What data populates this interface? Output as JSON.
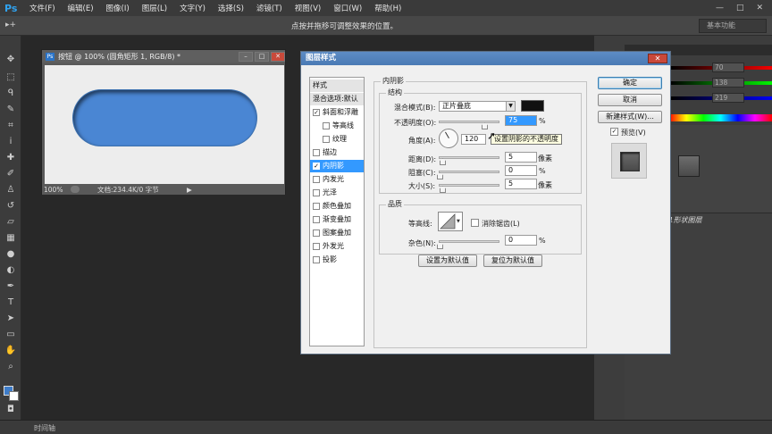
{
  "menubar": {
    "logo": "Ps",
    "items": [
      "文件(F)",
      "编辑(E)",
      "图像(I)",
      "图层(L)",
      "文字(Y)",
      "选择(S)",
      "滤镜(T)",
      "视图(V)",
      "窗口(W)",
      "帮助(H)"
    ],
    "minimize": "—",
    "maximize": "□",
    "close": "✕"
  },
  "optbar": {
    "tool_glyph": "▸+",
    "hint": "点按并拖移可调整效果的位置。",
    "workspace": "基本功能"
  },
  "document": {
    "title": "按钮 @ 100% (圆角矩形 1, RGB/8) *",
    "ps_badge": "Ps",
    "zoom": "100%",
    "info": "文档:234.4K/0 字节",
    "arrow": "▶"
  },
  "right_panel": {
    "r_value": "70",
    "g_value": "138",
    "b_value": "219",
    "layer_label": "效果 1形状图层"
  },
  "bottombar": {
    "timeline": "时间轴"
  },
  "dialog": {
    "title": "图层样式",
    "close": "✕",
    "style_list": [
      {
        "label": "样式",
        "type": "head"
      },
      {
        "label": "混合选项:默认",
        "type": "head"
      },
      {
        "label": "斜面和浮雕",
        "type": "check",
        "checked": true
      },
      {
        "label": "等高线",
        "type": "sub",
        "checked": false
      },
      {
        "label": "纹理",
        "type": "sub",
        "checked": false
      },
      {
        "label": "描边",
        "type": "check",
        "checked": false
      },
      {
        "label": "内阴影",
        "type": "check",
        "checked": true,
        "selected": true
      },
      {
        "label": "内发光",
        "type": "check",
        "checked": false
      },
      {
        "label": "光泽",
        "type": "check",
        "checked": false
      },
      {
        "label": "颜色叠加",
        "type": "check",
        "checked": false
      },
      {
        "label": "渐变叠加",
        "type": "check",
        "checked": false
      },
      {
        "label": "图案叠加",
        "type": "check",
        "checked": false
      },
      {
        "label": "外发光",
        "type": "check",
        "checked": false
      },
      {
        "label": "投影",
        "type": "check",
        "checked": false
      }
    ],
    "section_title": "内阴影",
    "structure": {
      "title": "结构",
      "blend_mode_label": "混合模式(B):",
      "blend_mode_value": "正片叠底",
      "opacity_label": "不透明度(O):",
      "opacity_value": "75",
      "opacity_level": 0.75,
      "percent": "%",
      "angle_label": "角度(A):",
      "angle_value": "120",
      "distance_label": "距离(D):",
      "distance_value": "5",
      "choke_label": "阻塞(C):",
      "choke_value": "0",
      "size_label": "大小(S):",
      "size_value": "5",
      "px": "像素",
      "shadow_color": "#111111"
    },
    "quality": {
      "title": "品质",
      "contour_label": "等高线:",
      "antialias_label": "消除锯齿(L)",
      "noise_label": "杂色(N):",
      "noise_value": "0",
      "percent": "%"
    },
    "make_default": "设置为默认值",
    "reset_default": "复位为默认值",
    "ok": "确定",
    "cancel": "取消",
    "new_style": "新建样式(W)...",
    "preview_label": "预览(V)",
    "tooltip": "设置阴影的不透明度"
  }
}
